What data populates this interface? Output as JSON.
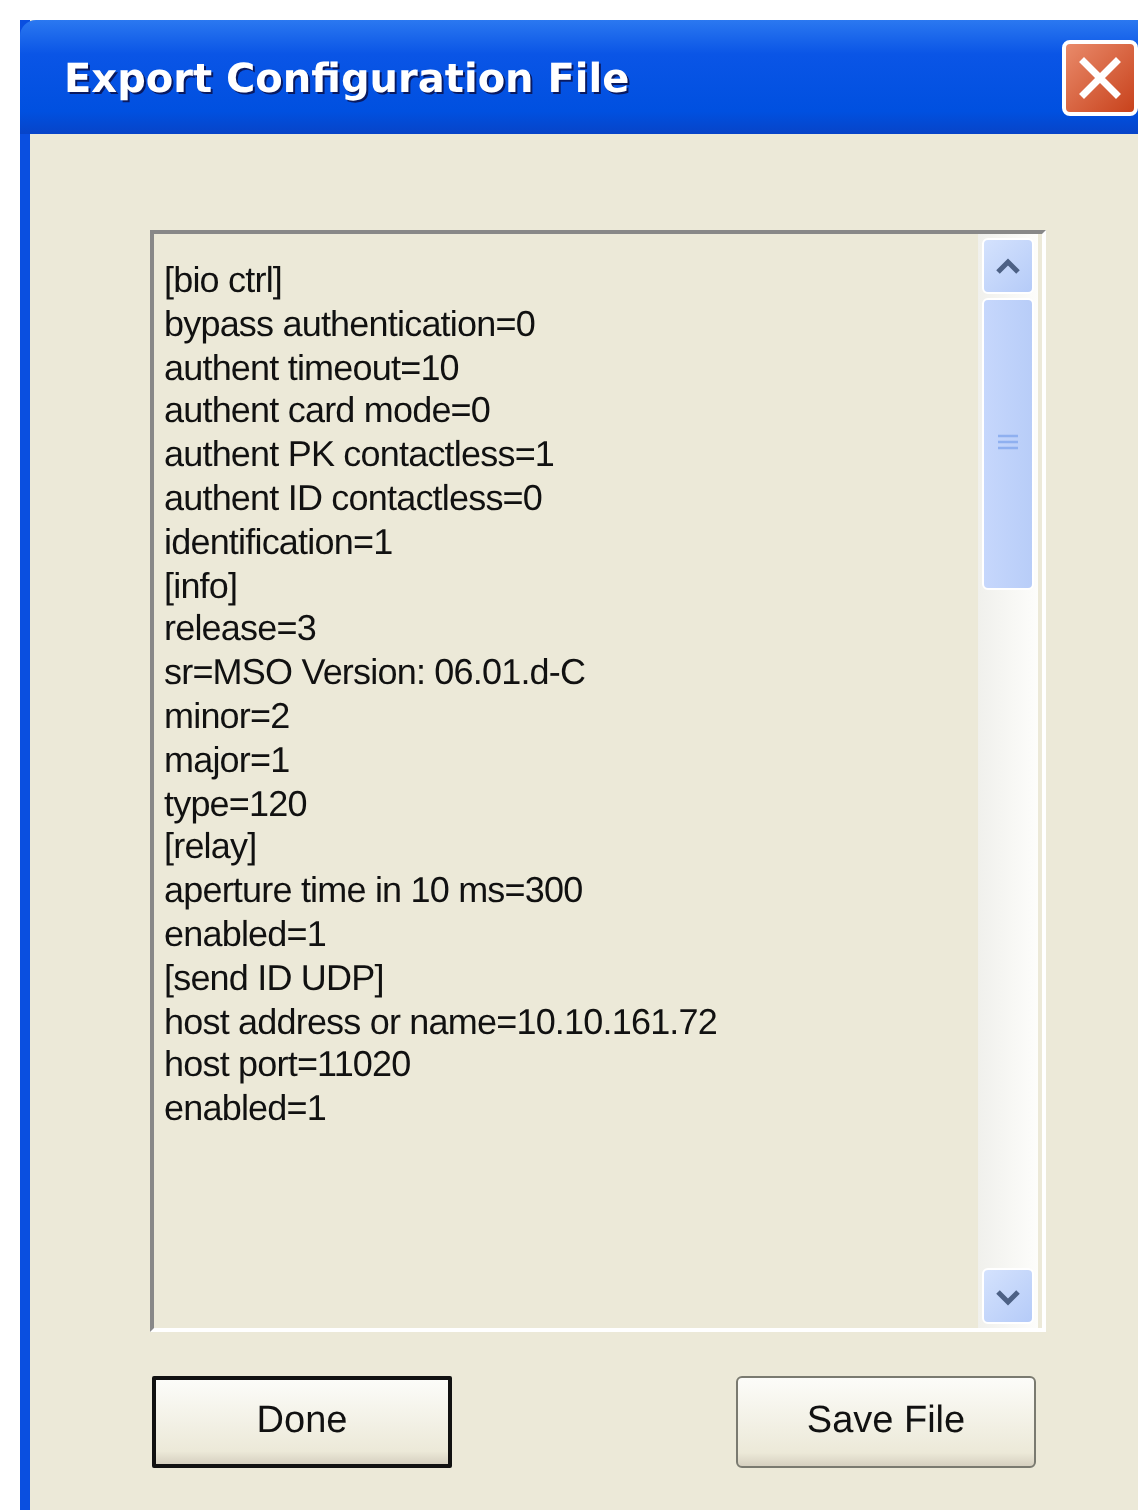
{
  "window": {
    "title": "Export Configuration File"
  },
  "file_text": {
    "lines": [
      "[bio ctrl]",
      "bypass authentication=0",
      "authent timeout=10",
      "authent card mode=0",
      "authent PK contactless=1",
      "authent ID contactless=0",
      "identification=1",
      "[info]",
      "release=3",
      "sr=MSO Version: 06.01.d-C",
      "minor=2",
      "major=1",
      "type=120",
      "[relay]",
      "aperture time in 10 ms=300",
      "enabled=1",
      "[send ID UDP]",
      "host address or name=10.10.161.72",
      "host port=11020",
      "enabled=1"
    ]
  },
  "buttons": [
    {
      "label": "Done",
      "default": true
    },
    {
      "label": "Save File",
      "default": false
    }
  ]
}
